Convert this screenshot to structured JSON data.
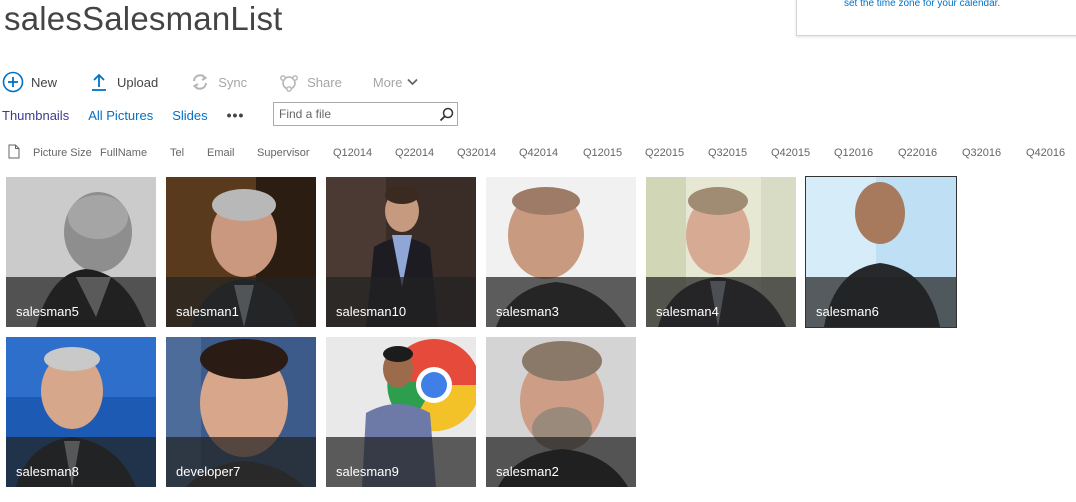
{
  "page": {
    "title": "salesSalesmanList"
  },
  "callout": {
    "link_text": "set the time zone for your calendar."
  },
  "toolbar": {
    "new_label": "New",
    "upload_label": "Upload",
    "sync_label": "Sync",
    "share_label": "Share",
    "more_label": "More"
  },
  "views": {
    "items": [
      "Thumbnails",
      "All Pictures",
      "Slides"
    ],
    "selected": "Thumbnails",
    "ellipsis": "•••"
  },
  "search": {
    "placeholder": "Find a file",
    "value": ""
  },
  "columns": [
    "Picture Size",
    "FullName",
    "Tel",
    "Email",
    "Supervisor",
    "Q12014",
    "Q22014",
    "Q32014",
    "Q42014",
    "Q12015",
    "Q22015",
    "Q32015",
    "Q42015",
    "Q12016",
    "Q22016",
    "Q32016",
    "Q42016"
  ],
  "thumbnails": [
    {
      "name": "salesman5"
    },
    {
      "name": "salesman1"
    },
    {
      "name": "salesman10"
    },
    {
      "name": "salesman3"
    },
    {
      "name": "salesman4"
    },
    {
      "name": "salesman6"
    },
    {
      "name": "salesman8"
    },
    {
      "name": "developer7"
    },
    {
      "name": "salesman9"
    },
    {
      "name": "salesman2"
    }
  ],
  "colors": {
    "accent": "#0072c6",
    "selected_view": "#3c3c8c",
    "caption_overlay": "#232323"
  },
  "icons": {
    "new": "plus-circle-icon",
    "upload": "upload-arrow-icon",
    "sync": "sync-icon",
    "share": "share-icon",
    "more": "chevron-down-icon",
    "search": "search-icon",
    "document": "document-icon"
  }
}
